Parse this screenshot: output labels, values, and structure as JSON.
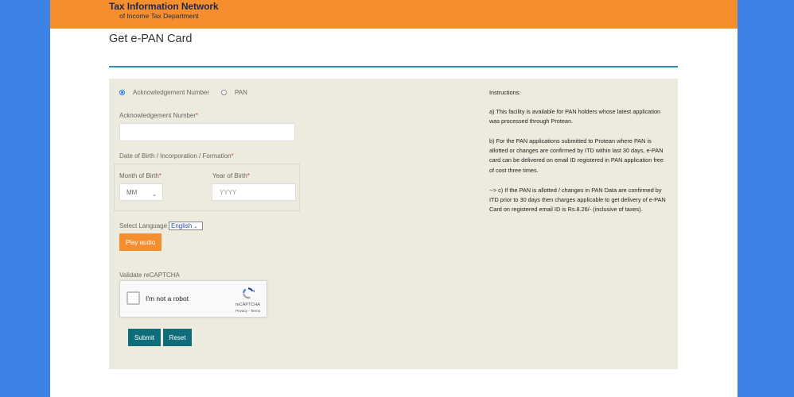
{
  "header": {
    "brand_title": "Tax Information Network",
    "brand_subtitle": "of Income Tax Department"
  },
  "page": {
    "title": "Get e-PAN Card"
  },
  "form": {
    "radio_ack_label": "Acknowledgement Number",
    "radio_pan_label": "PAN",
    "ack_label": "Acknowledgement Number",
    "required_mark": "*",
    "ack_value": "",
    "dob_label": "Date of Birth / Incorporation / Formation",
    "month_label": "Month of Birth",
    "month_value": "MM",
    "year_label": "Year of Birth",
    "year_placeholder": "YYYY",
    "language_label": "Select Language",
    "language_value": "English",
    "play_audio_label": "Play audio",
    "captcha_label": "Validate reCAPTCHA",
    "captcha_checkbox_text": "I'm not a robot",
    "captcha_brand": "reCAPTCHA",
    "captcha_links": "Privacy - Terms",
    "submit_label": "Submit",
    "reset_label": "Reset"
  },
  "instructions": {
    "heading": "Instructions:",
    "a": "a) This facility is available for PAN holders whose latest application was processed through Protean.",
    "b": "b) For the PAN applications submitted to Protean where PAN is allotted or changes are confirmed by ITD within last 30 days, e-PAN card can be delivered on email ID registered in PAN application free of cost three times.",
    "c": "--> c) If the PAN is allotted / changes in PAN Data are confirmed by ITD prior to 30 days then charges applicable to get delivery of e-PAN Card on registered email ID is Rs.8.26/- (inclusive of taxes)."
  },
  "colors": {
    "background": "#3f82e6",
    "header": "#f58e2c",
    "panel": "#edebdd",
    "button_teal": "#0e6d7a",
    "rule": "#2e8fb5"
  }
}
